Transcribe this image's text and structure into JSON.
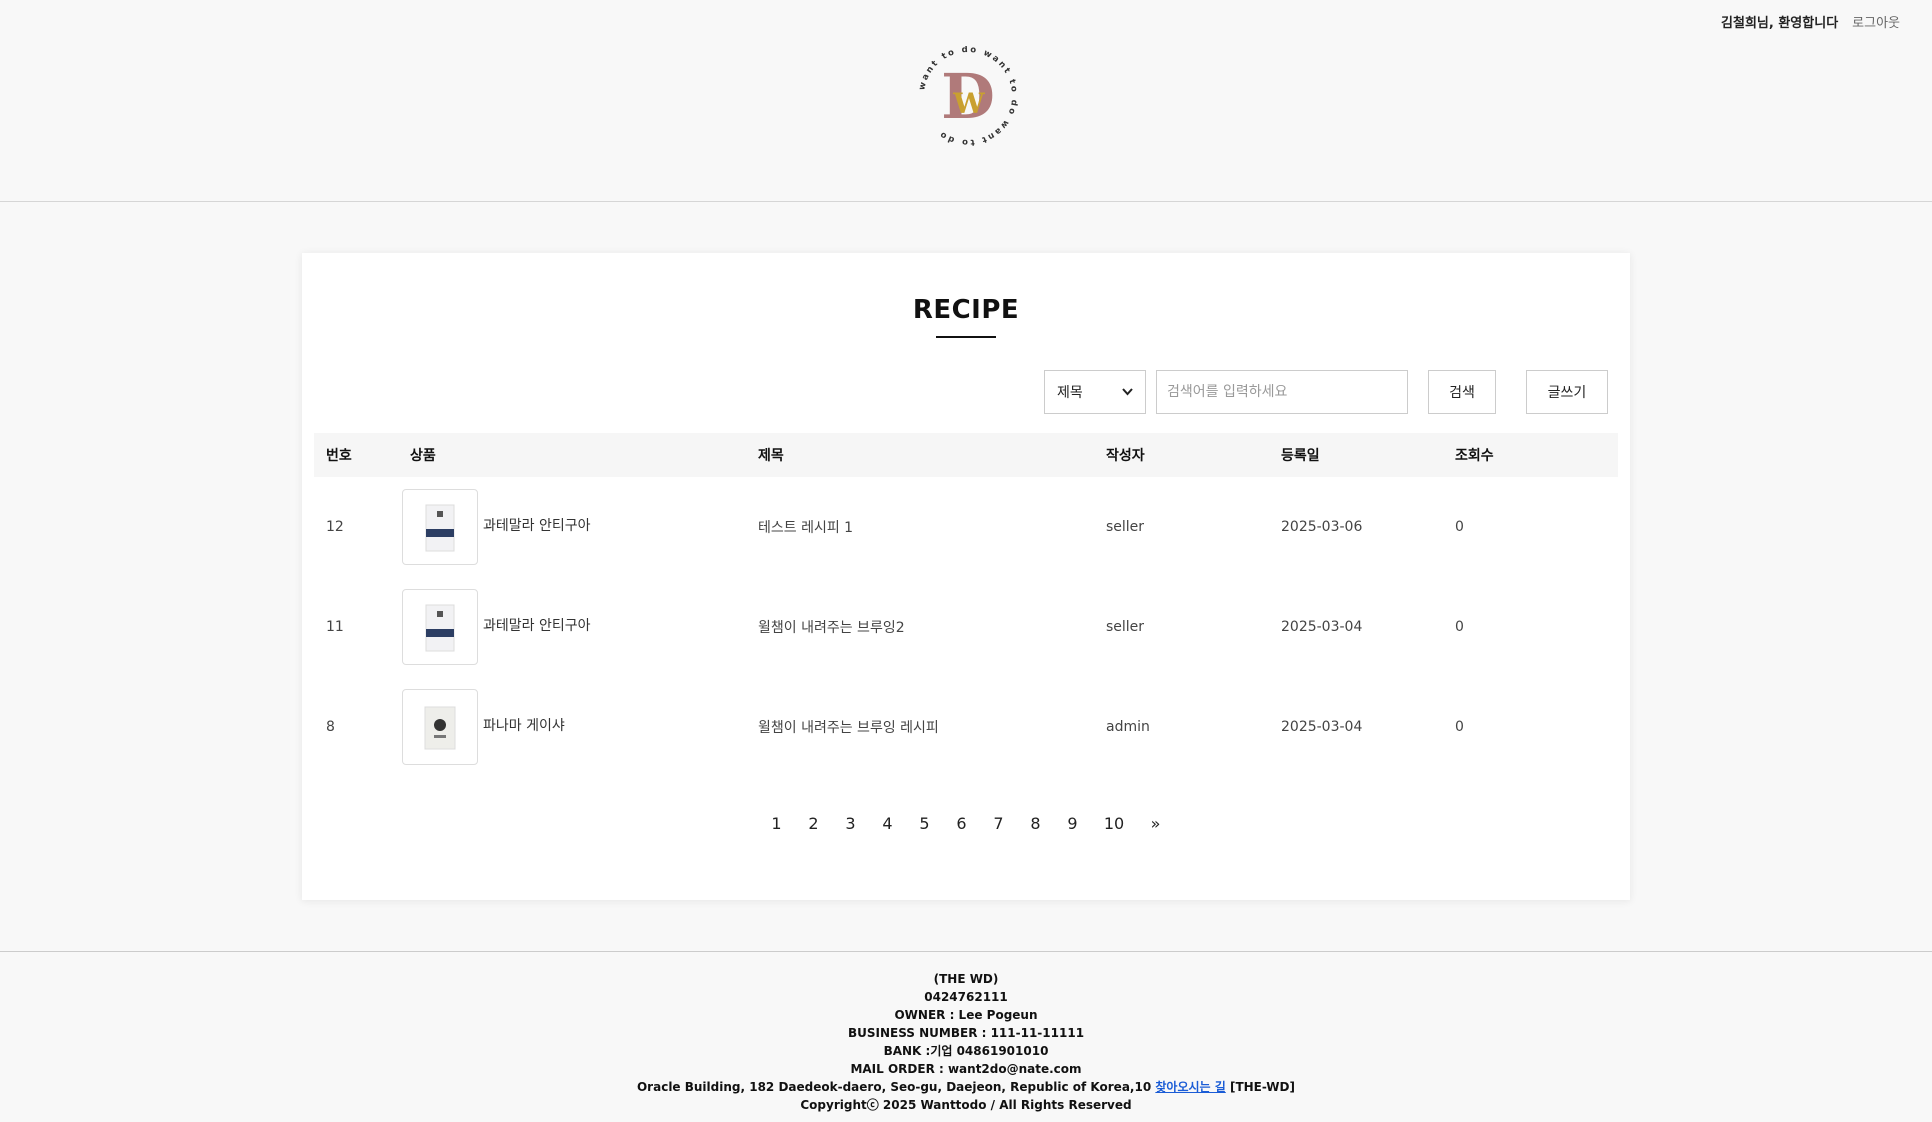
{
  "header": {
    "greeting": "김철희님, 환영합니다",
    "logout": "로그아웃",
    "logo_text": "want to do want to do want to do",
    "logo_letters": "D W"
  },
  "board": {
    "title": "RECIPE",
    "search_select": {
      "selected": "제목"
    },
    "search_placeholder": "검색어를 입력하세요",
    "search_button": "검색",
    "write_button": "글쓰기",
    "columns": [
      "번호",
      "상품",
      "제목",
      "작성자",
      "등록일",
      "조회수"
    ],
    "rows": [
      {
        "no": "12",
        "product": "과테말라 안티구아",
        "title": "테스트 레시피 1",
        "author": "seller",
        "date": "2025-03-06",
        "views": "0"
      },
      {
        "no": "11",
        "product": "과테말라 안티구아",
        "title": "윌챔이 내려주는 브루잉2",
        "author": "seller",
        "date": "2025-03-04",
        "views": "0"
      },
      {
        "no": "8",
        "product": "파나마 게이샤",
        "title": "윌챔이 내려주는 브루잉 레시피",
        "author": "admin",
        "date": "2025-03-04",
        "views": "0"
      }
    ],
    "pages": [
      "1",
      "2",
      "3",
      "4",
      "5",
      "6",
      "7",
      "8",
      "9",
      "10"
    ],
    "next_label": "»"
  },
  "footer": {
    "company": "(THE WD)",
    "phone": "0424762111",
    "owner": "OWNER : Lee Pogeun",
    "business_number": "BUSINESS NUMBER : 111-11-11111",
    "bank": "BANK :기업 04861901010",
    "mail_order": "MAIL ORDER : want2do@nate.com",
    "address": "Oracle Building, 182 Daedeok-daero, Seo-gu, Daejeon, Republic of Korea,10",
    "directions_link": "찾아오시는 길",
    "address_suffix": " [THE-WD]",
    "copyright": "Copyrightⓒ 2025 Wanttodo / All Rights Reserved"
  },
  "colors": {
    "logo_d": "#b07a7a",
    "logo_w": "#c9a030",
    "link": "#1a5cd6"
  }
}
